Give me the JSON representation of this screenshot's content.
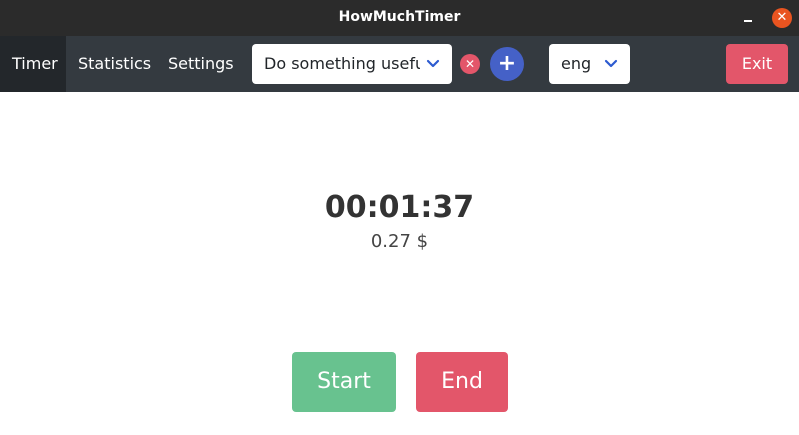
{
  "window": {
    "title": "HowMuchTimer",
    "minimize_icon": "minimize-icon",
    "close_icon": "close-icon",
    "close_glyph": "✕",
    "close_color": "#e95420"
  },
  "navbar": {
    "items": [
      {
        "label": "Timer",
        "active": true
      },
      {
        "label": "Statistics",
        "active": false
      },
      {
        "label": "Settings",
        "active": false
      }
    ],
    "task_select": {
      "value": "Do something usefu",
      "icon": "chevron-down-icon"
    },
    "remove_task": {
      "glyph": "✕",
      "icon": "close-circle-icon",
      "color": "#e3566a"
    },
    "add_task": {
      "glyph": "+",
      "icon": "plus-icon",
      "color": "#4561c7"
    },
    "language_select": {
      "value": "eng",
      "icon": "chevron-down-icon"
    },
    "exit_label": "Exit"
  },
  "main": {
    "elapsed": "00:01:37",
    "cost": "0.27 $",
    "start_label": "Start",
    "end_label": "End"
  },
  "colors": {
    "navbar_bg": "#343a40",
    "start": "#68c28f",
    "end": "#e3566a",
    "accent_blue": "#2d5bd0"
  }
}
